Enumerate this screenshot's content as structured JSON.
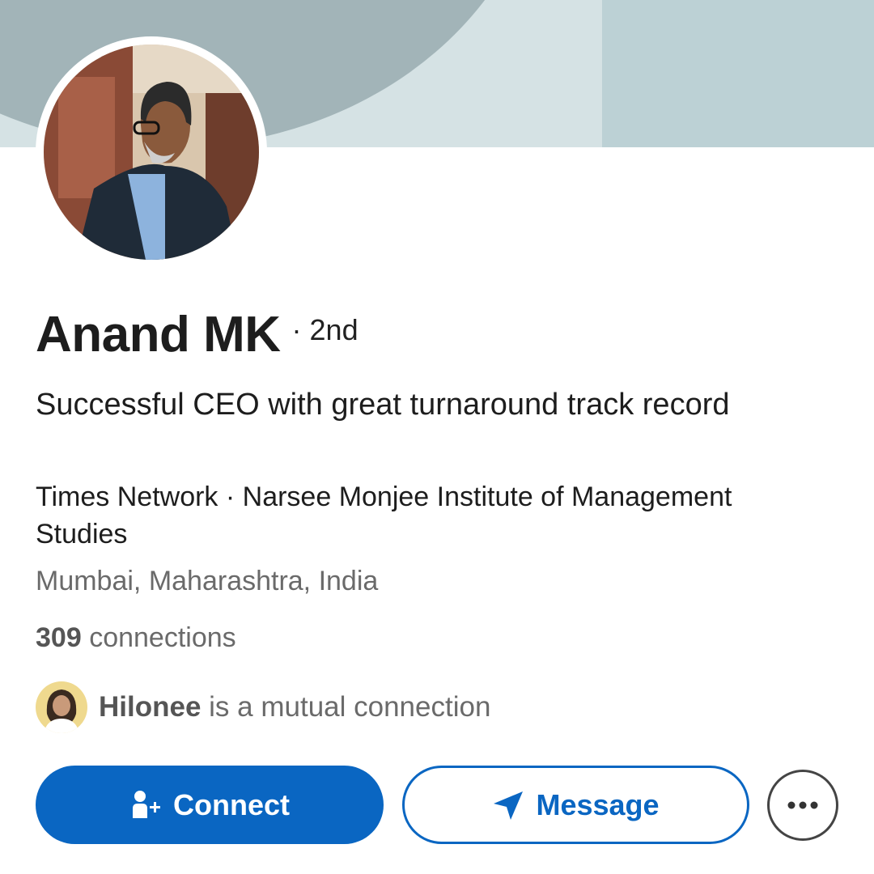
{
  "profile": {
    "name": "Anand MK",
    "degree": "· 2nd",
    "headline": "Successful CEO with great turnaround track record",
    "company": "Times Network · Narsee Monjee Institute of Management Studies",
    "location": "Mumbai, Maharashtra, India",
    "connections_count": "309",
    "connections_label": "connections"
  },
  "mutual": {
    "name": "Hilonee",
    "text": "is a mutual connection"
  },
  "actions": {
    "connect_label": "Connect",
    "message_label": "Message",
    "more_icon": "more-horizontal-icon",
    "connect_icon": "add-person-icon",
    "message_icon": "send-icon"
  },
  "colors": {
    "primary": "#0a66c2",
    "banner_dark": "#a2b4b8",
    "banner_light": "#d5e2e4",
    "banner_right": "#bcd1d5"
  }
}
